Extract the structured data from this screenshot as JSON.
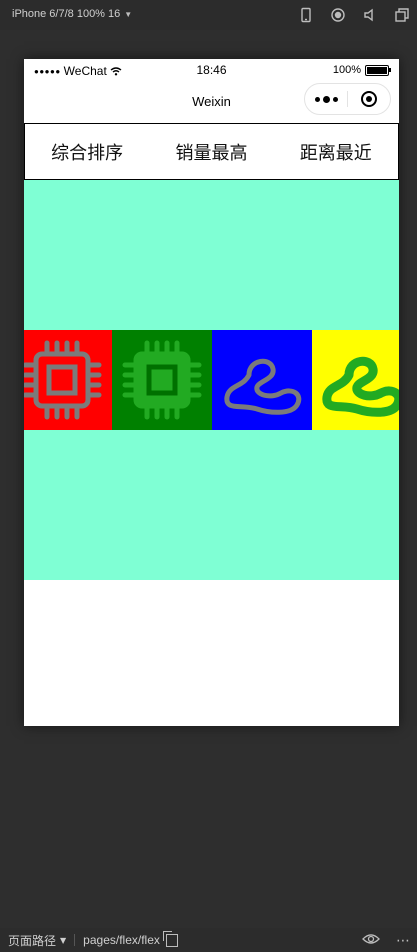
{
  "simulator": {
    "device_label": "iPhone 6/7/8 100% 16",
    "bottom_path_label": "页面路径",
    "page_path": "pages/flex/flex"
  },
  "status_bar": {
    "carrier": "WeChat",
    "time": "18:46",
    "battery": "100%"
  },
  "nav": {
    "title": "Weixin"
  },
  "tabs": [
    {
      "label": "综合排序"
    },
    {
      "label": "销量最高"
    },
    {
      "label": "距离最近"
    }
  ],
  "colors": {
    "flex_background": "#7fffd4",
    "tiles": [
      "#ff0000",
      "#008000",
      "#0000ff",
      "#ffff00"
    ],
    "chip_icon_on_red": "#7b7b7b",
    "chip_icon_on_green": "#22aa22",
    "cloud_icon_on_blue": "#7b7b7b",
    "cloud_icon_on_yellow": "#22aa22"
  },
  "tiles": [
    {
      "icon": "chip-icon",
      "background": "red"
    },
    {
      "icon": "chip-icon",
      "background": "green"
    },
    {
      "icon": "cloud-icon",
      "background": "blue"
    },
    {
      "icon": "cloud-icon",
      "background": "yellow"
    }
  ]
}
